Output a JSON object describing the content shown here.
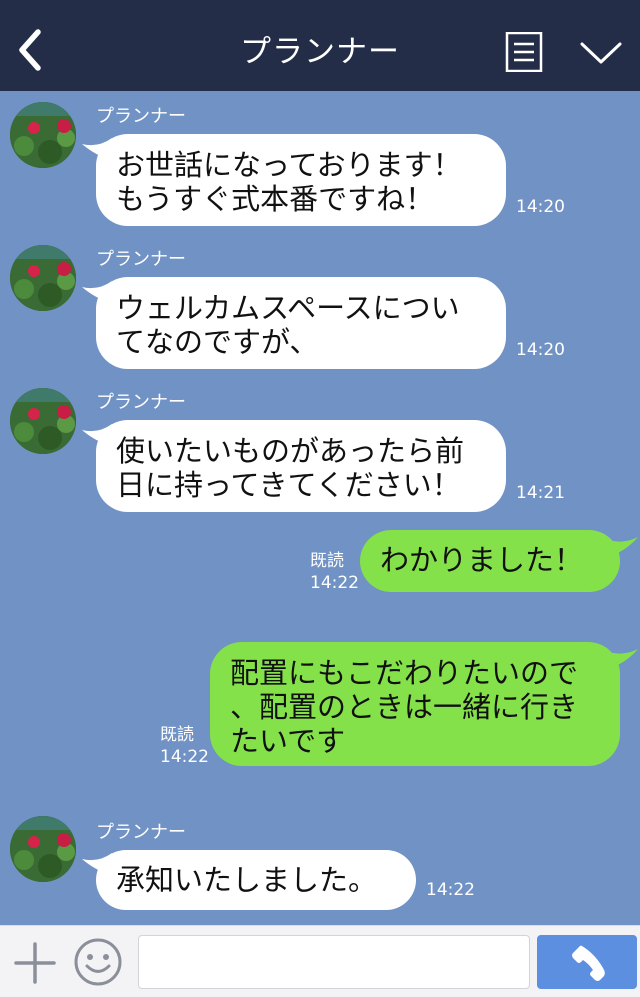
{
  "header": {
    "title": "プランナー"
  },
  "messages": [
    {
      "sender": "プランナー",
      "lines": [
        "お世話になっております！",
        "もうすぐ式本番ですね！"
      ],
      "time": "14:20"
    },
    {
      "sender": "プランナー",
      "lines": [
        "ウェルカムスペースについ",
        "てなのですが、"
      ],
      "time": "14:20"
    },
    {
      "sender": "プランナー",
      "lines": [
        "使いたいものがあったら前",
        "日に持ってきてください！"
      ],
      "time": "14:21"
    },
    {
      "lines": [
        "わかりました！"
      ],
      "read": "既読",
      "time": "14:22"
    },
    {
      "lines": [
        "配置にもこだわりたいので",
        "、配置のときは一緒に行き",
        "たいです"
      ],
      "read": "既読",
      "time": "14:22"
    },
    {
      "sender": "プランナー",
      "lines": [
        "承知いたしました。"
      ],
      "time": "14:22"
    }
  ],
  "footer": {
    "input_placeholder": ""
  },
  "colors": {
    "header_bg": "#232d48",
    "chat_bg": "#7192c4",
    "outgoing_bubble": "#84e14a",
    "incoming_bubble": "#ffffff",
    "call_button": "#5c8fe0"
  },
  "icons": {
    "back": "chevron-left-icon",
    "menu": "menu-icon",
    "collapse": "chevron-down-icon",
    "plus": "plus-icon",
    "sticker": "smile-icon",
    "call": "phone-icon"
  }
}
